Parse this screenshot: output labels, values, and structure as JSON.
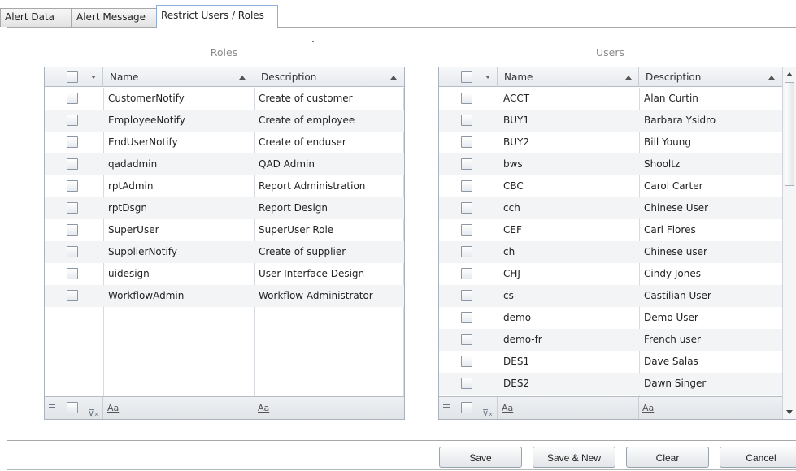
{
  "tabs": [
    {
      "label": "Alert Data",
      "active": false
    },
    {
      "label": "Alert Message",
      "active": false
    },
    {
      "label": "Restrict Users / Roles",
      "active": true
    }
  ],
  "roles": {
    "title": "Roles",
    "columns": {
      "name": "Name",
      "description": "Description"
    },
    "rows": [
      {
        "name": "CustomerNotify",
        "description": "Create of customer"
      },
      {
        "name": "EmployeeNotify",
        "description": "Create of employee"
      },
      {
        "name": "EndUserNotify",
        "description": "Create of enduser"
      },
      {
        "name": "qadadmin",
        "description": "QAD Admin"
      },
      {
        "name": "rptAdmin",
        "description": "Report Administration"
      },
      {
        "name": "rptDsgn",
        "description": "Report Design"
      },
      {
        "name": "SuperUser",
        "description": "SuperUser Role"
      },
      {
        "name": "SupplierNotify",
        "description": "Create of supplier"
      },
      {
        "name": "uidesign",
        "description": "User Interface Design"
      },
      {
        "name": "WorkflowAdmin",
        "description": "Workflow Administrator"
      }
    ],
    "footer": {
      "filter_name": "Aa",
      "filter_description": "Aa"
    }
  },
  "users": {
    "title": "Users",
    "columns": {
      "name": "Name",
      "description": "Description"
    },
    "rows": [
      {
        "name": "ACCT",
        "description": "Alan Curtin"
      },
      {
        "name": "BUY1",
        "description": "Barbara Ysidro"
      },
      {
        "name": "BUY2",
        "description": "Bill Young"
      },
      {
        "name": "bws",
        "description": " Shooltz"
      },
      {
        "name": "CBC",
        "description": "Carol Carter"
      },
      {
        "name": "cch",
        "description": "Chinese User"
      },
      {
        "name": "CEF",
        "description": "Carl Flores"
      },
      {
        "name": "ch",
        "description": "Chinese user"
      },
      {
        "name": "CHJ",
        "description": "Cindy Jones"
      },
      {
        "name": "cs",
        "description": "Castilian User"
      },
      {
        "name": "demo",
        "description": "Demo User"
      },
      {
        "name": "demo-fr",
        "description": "French user"
      },
      {
        "name": "DES1",
        "description": "Dave Salas"
      },
      {
        "name": "DES2",
        "description": "Dawn Singer"
      }
    ],
    "footer": {
      "filter_name": "Aa",
      "filter_description": "Aa"
    }
  },
  "buttons": {
    "save": "Save",
    "save_new": "Save & New",
    "clear": "Clear",
    "cancel": "Cancel"
  },
  "colors": {
    "active_tab_border": "#8fb0d6",
    "row_alt": "#f3f4f6"
  }
}
